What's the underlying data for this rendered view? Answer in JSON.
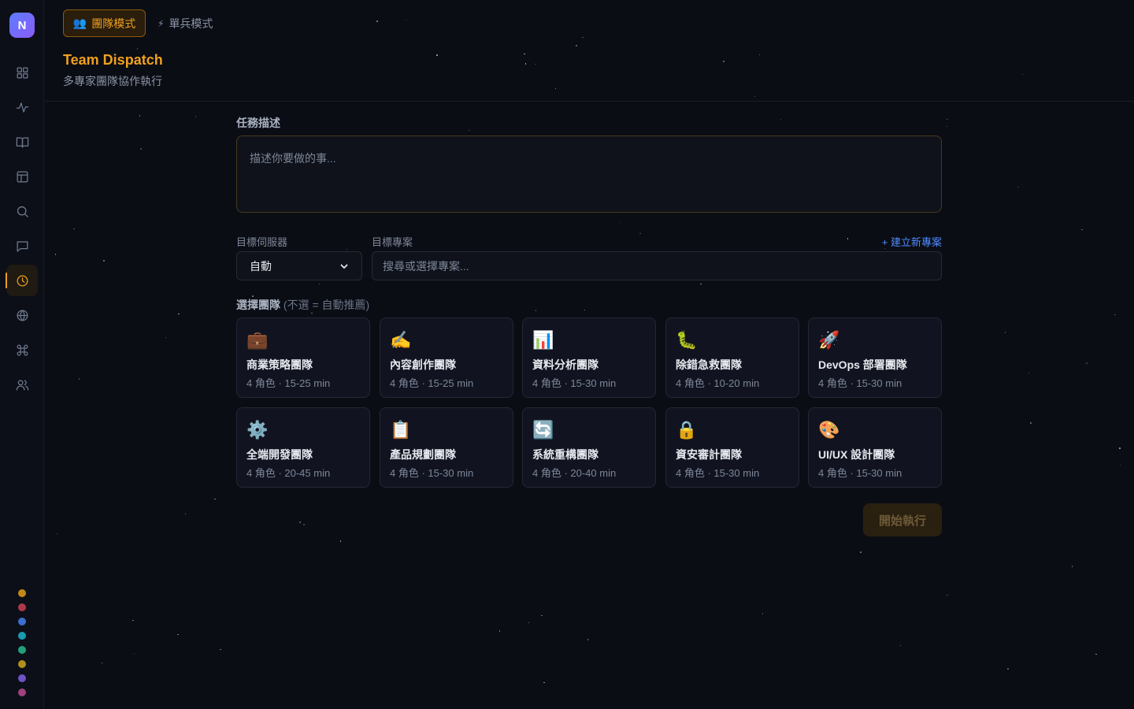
{
  "sidebar": {
    "logo": "N",
    "icons": [
      "grid-icon",
      "activity-icon",
      "book-icon",
      "layout-icon",
      "search-icon",
      "chat-icon",
      "clock-icon",
      "globe-icon",
      "command-icon",
      "users-icon"
    ],
    "active": "clock-icon",
    "status_dots": [
      "#c08a18",
      "#b0374a",
      "#3b6fd0",
      "#1a9bb0",
      "#22a07a",
      "#b08f1c",
      "#6f52c8",
      "#a0407e"
    ]
  },
  "header": {
    "tabs": [
      {
        "icon": "👥",
        "label": "團隊模式",
        "active": true
      },
      {
        "icon": "⚡",
        "label": "單兵模式",
        "active": false
      }
    ],
    "title": "Team Dispatch",
    "subtitle": "多專家團隊協作執行"
  },
  "form": {
    "task_label": "任務描述",
    "task_placeholder": "描述你要做的事...",
    "server_label": "目標伺服器",
    "server_value": "自動",
    "project_label": "目標專案",
    "new_project_link": "+ 建立新專案",
    "project_placeholder": "搜尋或選擇專案...",
    "team_label": "選擇團隊",
    "team_hint": "(不選 = 自動推薦)"
  },
  "teams": [
    {
      "icon": "💼",
      "name": "商業策略團隊",
      "meta": "4 角色 · 15-25 min"
    },
    {
      "icon": "✍️",
      "name": "內容創作團隊",
      "meta": "4 角色 · 15-25 min"
    },
    {
      "icon": "📊",
      "name": "資料分析團隊",
      "meta": "4 角色 · 15-30 min"
    },
    {
      "icon": "🐛",
      "name": "除錯急救團隊",
      "meta": "4 角色 · 10-20 min"
    },
    {
      "icon": "🚀",
      "name": "DevOps 部署團隊",
      "meta": "4 角色 · 15-30 min"
    },
    {
      "icon": "⚙️",
      "name": "全端開發團隊",
      "meta": "4 角色 · 20-45 min"
    },
    {
      "icon": "📋",
      "name": "產品規劃團隊",
      "meta": "4 角色 · 15-30 min"
    },
    {
      "icon": "🔄",
      "name": "系統重構團隊",
      "meta": "4 角色 · 20-40 min"
    },
    {
      "icon": "🔒",
      "name": "資安審計團隊",
      "meta": "4 角色 · 15-30 min"
    },
    {
      "icon": "🎨",
      "name": "UI/UX 設計團隊",
      "meta": "4 角色 · 15-30 min"
    }
  ],
  "actions": {
    "start_label": "開始執行"
  },
  "colors": {
    "accent": "#f0a020",
    "link": "#4f8cff",
    "background": "#0b0d14"
  }
}
